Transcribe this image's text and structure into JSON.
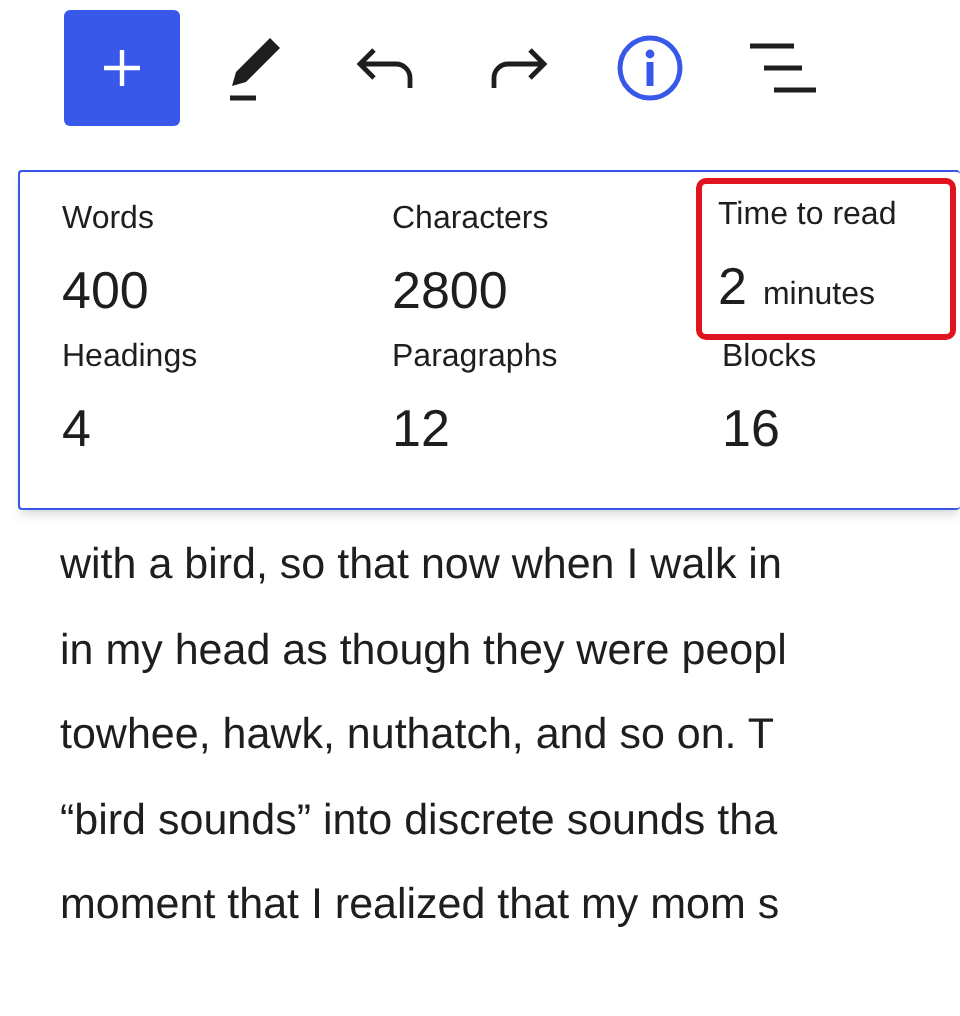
{
  "toolbar": [
    {
      "kind": "add",
      "selected": true
    },
    {
      "kind": "pencil",
      "selected": false
    },
    {
      "kind": "undo",
      "selected": false
    },
    {
      "kind": "redo",
      "selected": false
    },
    {
      "kind": "info",
      "selected": true
    },
    {
      "kind": "outline",
      "selected": false
    }
  ],
  "stats": [
    {
      "label": "Words",
      "value": "400",
      "highlighted": false
    },
    {
      "label": "Characters",
      "value": "2800",
      "highlighted": false
    },
    {
      "label": "Time to read",
      "value": "2",
      "unit": "minutes",
      "highlighted": true
    },
    {
      "label": "Headings",
      "value": "4",
      "highlighted": false
    },
    {
      "label": "Paragraphs",
      "value": "12",
      "highlighted": false
    },
    {
      "label": "Blocks",
      "value": "16",
      "highlighted": false
    }
  ],
  "body_lines": [
    "with a bird, so that now when I walk in",
    "in my head as though they were peopl",
    "towhee, hawk, nuthatch, and so on. T",
    "“bird sounds” into discrete sounds tha",
    "moment that I realized that my mom s"
  ]
}
